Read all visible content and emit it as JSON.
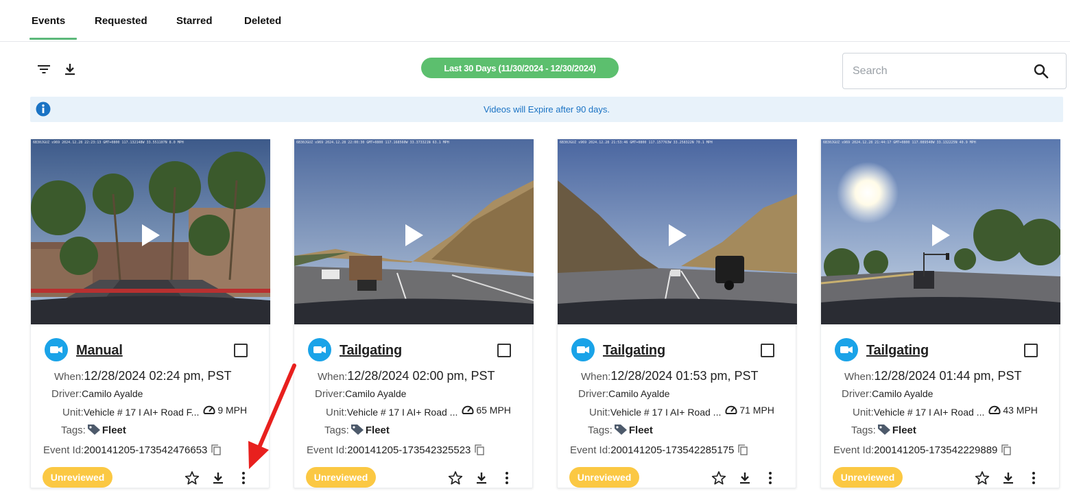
{
  "tabs": [
    {
      "label": "Events",
      "active": true
    },
    {
      "label": "Requested",
      "active": false
    },
    {
      "label": "Starred",
      "active": false
    },
    {
      "label": "Deleted",
      "active": false
    }
  ],
  "toolbar": {
    "filter_icon": "filter-icon",
    "download_icon": "download-icon",
    "date_range": "Last 30 Days (11/30/2024 - 12/30/2024)",
    "date_range_color": "#5cbf6e"
  },
  "search": {
    "placeholder": "Search",
    "value": "",
    "icon": "search-icon"
  },
  "banner": {
    "icon": "info-icon",
    "text": "Videos will Expire after 90 days."
  },
  "labels": {
    "when": "When:",
    "driver": "Driver:",
    "unit": "Unit:",
    "tags": "Tags:",
    "event_id": "Event Id:"
  },
  "cards": [
    {
      "overlay": "6B30JGUZ s969 2024.12.28 22:23:13 GMT+0800 117.132148W 33.551107N 8.0 MPH",
      "event_type": "Manual",
      "when": "12/28/2024 02:24 pm, PST",
      "driver": "Camilo Ayalde",
      "unit": "Vehicle # 17 I AI+ Road F...",
      "speed": "9 MPH",
      "tag": "Fleet",
      "event_id": "200141205-173542476653",
      "status": "Unreviewed"
    },
    {
      "overlay": "6B30JGUZ s969 2024.12.28 22:00:30 GMT+0800 117.168560W 33.373321N 63.1 MPH",
      "event_type": "Tailgating",
      "when": "12/28/2024 02:00 pm, PST",
      "driver": "Camilo Ayalde",
      "unit": "Vehicle # 17 I AI+ Road ...",
      "speed": "65 MPH",
      "tag": "Fleet",
      "event_id": "200141205-173542325523",
      "status": "Unreviewed"
    },
    {
      "overlay": "6B30JGUZ s969 2024.12.28 21:53:46 GMT+0800 117.157763W 33.258322N 70.1 MPH",
      "event_type": "Tailgating",
      "when": "12/28/2024 01:53 pm, PST",
      "driver": "Camilo Ayalde",
      "unit": "Vehicle # 17 I AI+ Road ...",
      "speed": "71 MPH",
      "tag": "Fleet",
      "event_id": "200141205-173542285175",
      "status": "Unreviewed"
    },
    {
      "overlay": "6B30JGUZ s969 2024.12.28 21:44:17 GMT+0800 117.089540W 33.132225N 40.9 MPH",
      "event_type": "Tailgating",
      "when": "12/28/2024 01:44 pm, PST",
      "driver": "Camilo Ayalde",
      "unit": "Vehicle # 17 I AI+ Road ...",
      "speed": "43 MPH",
      "tag": "Fleet",
      "event_id": "200141205-173542229889",
      "status": "Unreviewed"
    }
  ],
  "colors": {
    "accent_green": "#5cb87a",
    "camera_blue": "#1aa3e8",
    "unreviewed_yellow": "#fbc843",
    "banner_bg": "#e8f2fa",
    "banner_text": "#1a73c4",
    "annotation_red": "#e8201e"
  }
}
